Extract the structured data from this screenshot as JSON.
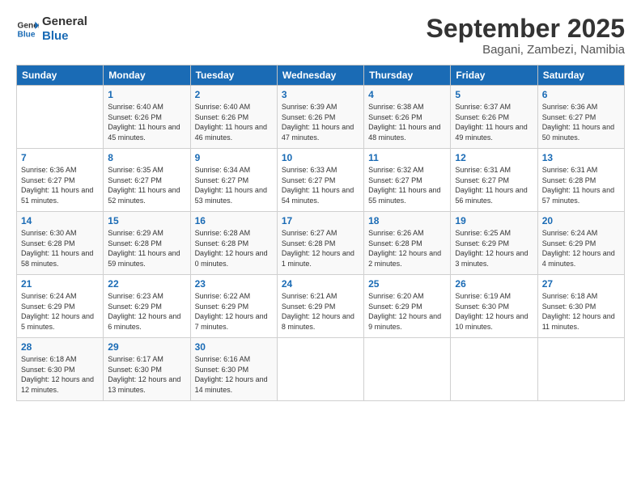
{
  "logo": {
    "line1": "General",
    "line2": "Blue"
  },
  "title": "September 2025",
  "location": "Bagani, Zambezi, Namibia",
  "weekdays": [
    "Sunday",
    "Monday",
    "Tuesday",
    "Wednesday",
    "Thursday",
    "Friday",
    "Saturday"
  ],
  "weeks": [
    [
      {
        "day": "",
        "sunrise": "",
        "sunset": "",
        "daylight": ""
      },
      {
        "day": "1",
        "sunrise": "Sunrise: 6:40 AM",
        "sunset": "Sunset: 6:26 PM",
        "daylight": "Daylight: 11 hours and 45 minutes."
      },
      {
        "day": "2",
        "sunrise": "Sunrise: 6:40 AM",
        "sunset": "Sunset: 6:26 PM",
        "daylight": "Daylight: 11 hours and 46 minutes."
      },
      {
        "day": "3",
        "sunrise": "Sunrise: 6:39 AM",
        "sunset": "Sunset: 6:26 PM",
        "daylight": "Daylight: 11 hours and 47 minutes."
      },
      {
        "day": "4",
        "sunrise": "Sunrise: 6:38 AM",
        "sunset": "Sunset: 6:26 PM",
        "daylight": "Daylight: 11 hours and 48 minutes."
      },
      {
        "day": "5",
        "sunrise": "Sunrise: 6:37 AM",
        "sunset": "Sunset: 6:26 PM",
        "daylight": "Daylight: 11 hours and 49 minutes."
      },
      {
        "day": "6",
        "sunrise": "Sunrise: 6:36 AM",
        "sunset": "Sunset: 6:27 PM",
        "daylight": "Daylight: 11 hours and 50 minutes."
      }
    ],
    [
      {
        "day": "7",
        "sunrise": "Sunrise: 6:36 AM",
        "sunset": "Sunset: 6:27 PM",
        "daylight": "Daylight: 11 hours and 51 minutes."
      },
      {
        "day": "8",
        "sunrise": "Sunrise: 6:35 AM",
        "sunset": "Sunset: 6:27 PM",
        "daylight": "Daylight: 11 hours and 52 minutes."
      },
      {
        "day": "9",
        "sunrise": "Sunrise: 6:34 AM",
        "sunset": "Sunset: 6:27 PM",
        "daylight": "Daylight: 11 hours and 53 minutes."
      },
      {
        "day": "10",
        "sunrise": "Sunrise: 6:33 AM",
        "sunset": "Sunset: 6:27 PM",
        "daylight": "Daylight: 11 hours and 54 minutes."
      },
      {
        "day": "11",
        "sunrise": "Sunrise: 6:32 AM",
        "sunset": "Sunset: 6:27 PM",
        "daylight": "Daylight: 11 hours and 55 minutes."
      },
      {
        "day": "12",
        "sunrise": "Sunrise: 6:31 AM",
        "sunset": "Sunset: 6:27 PM",
        "daylight": "Daylight: 11 hours and 56 minutes."
      },
      {
        "day": "13",
        "sunrise": "Sunrise: 6:31 AM",
        "sunset": "Sunset: 6:28 PM",
        "daylight": "Daylight: 11 hours and 57 minutes."
      }
    ],
    [
      {
        "day": "14",
        "sunrise": "Sunrise: 6:30 AM",
        "sunset": "Sunset: 6:28 PM",
        "daylight": "Daylight: 11 hours and 58 minutes."
      },
      {
        "day": "15",
        "sunrise": "Sunrise: 6:29 AM",
        "sunset": "Sunset: 6:28 PM",
        "daylight": "Daylight: 11 hours and 59 minutes."
      },
      {
        "day": "16",
        "sunrise": "Sunrise: 6:28 AM",
        "sunset": "Sunset: 6:28 PM",
        "daylight": "Daylight: 12 hours and 0 minutes."
      },
      {
        "day": "17",
        "sunrise": "Sunrise: 6:27 AM",
        "sunset": "Sunset: 6:28 PM",
        "daylight": "Daylight: 12 hours and 1 minute."
      },
      {
        "day": "18",
        "sunrise": "Sunrise: 6:26 AM",
        "sunset": "Sunset: 6:28 PM",
        "daylight": "Daylight: 12 hours and 2 minutes."
      },
      {
        "day": "19",
        "sunrise": "Sunrise: 6:25 AM",
        "sunset": "Sunset: 6:29 PM",
        "daylight": "Daylight: 12 hours and 3 minutes."
      },
      {
        "day": "20",
        "sunrise": "Sunrise: 6:24 AM",
        "sunset": "Sunset: 6:29 PM",
        "daylight": "Daylight: 12 hours and 4 minutes."
      }
    ],
    [
      {
        "day": "21",
        "sunrise": "Sunrise: 6:24 AM",
        "sunset": "Sunset: 6:29 PM",
        "daylight": "Daylight: 12 hours and 5 minutes."
      },
      {
        "day": "22",
        "sunrise": "Sunrise: 6:23 AM",
        "sunset": "Sunset: 6:29 PM",
        "daylight": "Daylight: 12 hours and 6 minutes."
      },
      {
        "day": "23",
        "sunrise": "Sunrise: 6:22 AM",
        "sunset": "Sunset: 6:29 PM",
        "daylight": "Daylight: 12 hours and 7 minutes."
      },
      {
        "day": "24",
        "sunrise": "Sunrise: 6:21 AM",
        "sunset": "Sunset: 6:29 PM",
        "daylight": "Daylight: 12 hours and 8 minutes."
      },
      {
        "day": "25",
        "sunrise": "Sunrise: 6:20 AM",
        "sunset": "Sunset: 6:29 PM",
        "daylight": "Daylight: 12 hours and 9 minutes."
      },
      {
        "day": "26",
        "sunrise": "Sunrise: 6:19 AM",
        "sunset": "Sunset: 6:30 PM",
        "daylight": "Daylight: 12 hours and 10 minutes."
      },
      {
        "day": "27",
        "sunrise": "Sunrise: 6:18 AM",
        "sunset": "Sunset: 6:30 PM",
        "daylight": "Daylight: 12 hours and 11 minutes."
      }
    ],
    [
      {
        "day": "28",
        "sunrise": "Sunrise: 6:18 AM",
        "sunset": "Sunset: 6:30 PM",
        "daylight": "Daylight: 12 hours and 12 minutes."
      },
      {
        "day": "29",
        "sunrise": "Sunrise: 6:17 AM",
        "sunset": "Sunset: 6:30 PM",
        "daylight": "Daylight: 12 hours and 13 minutes."
      },
      {
        "day": "30",
        "sunrise": "Sunrise: 6:16 AM",
        "sunset": "Sunset: 6:30 PM",
        "daylight": "Daylight: 12 hours and 14 minutes."
      },
      {
        "day": "",
        "sunrise": "",
        "sunset": "",
        "daylight": ""
      },
      {
        "day": "",
        "sunrise": "",
        "sunset": "",
        "daylight": ""
      },
      {
        "day": "",
        "sunrise": "",
        "sunset": "",
        "daylight": ""
      },
      {
        "day": "",
        "sunrise": "",
        "sunset": "",
        "daylight": ""
      }
    ]
  ]
}
